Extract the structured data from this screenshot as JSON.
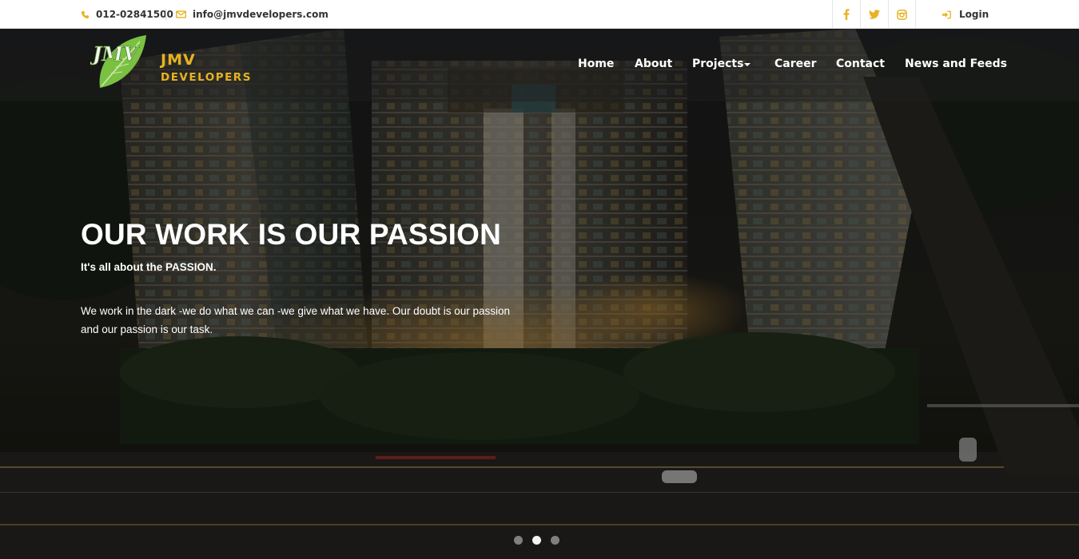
{
  "topbar": {
    "phone": "012-02841500",
    "email": "info@jmvdevelopers.com",
    "social_icons": [
      "facebook-icon",
      "twitter-icon",
      "instagram-icon"
    ],
    "login_label": "Login"
  },
  "brand": {
    "logo_mark": "JMV",
    "name_line1": "JMV",
    "name_line2": "DEVELOPERS"
  },
  "nav": {
    "items": [
      {
        "label": "Home"
      },
      {
        "label": "About"
      },
      {
        "label": "Projects",
        "has_dropdown": true
      },
      {
        "label": "Career"
      },
      {
        "label": "Contact"
      },
      {
        "label": "News and Feeds"
      }
    ]
  },
  "hero": {
    "headline": "OUR WORK IS OUR PASSION",
    "subheadline": "It's all about the PASSION.",
    "body": "We work in the dark -we do what we can -we give what we have. Our doubt is our passion and our passion is our task.",
    "slides_total": 3,
    "active_slide": 2
  },
  "colors": {
    "accent": "#e8b222",
    "leaf_green": "#7ac142",
    "topbar_bg": "#ffffff",
    "topbar_text": "#333333"
  }
}
